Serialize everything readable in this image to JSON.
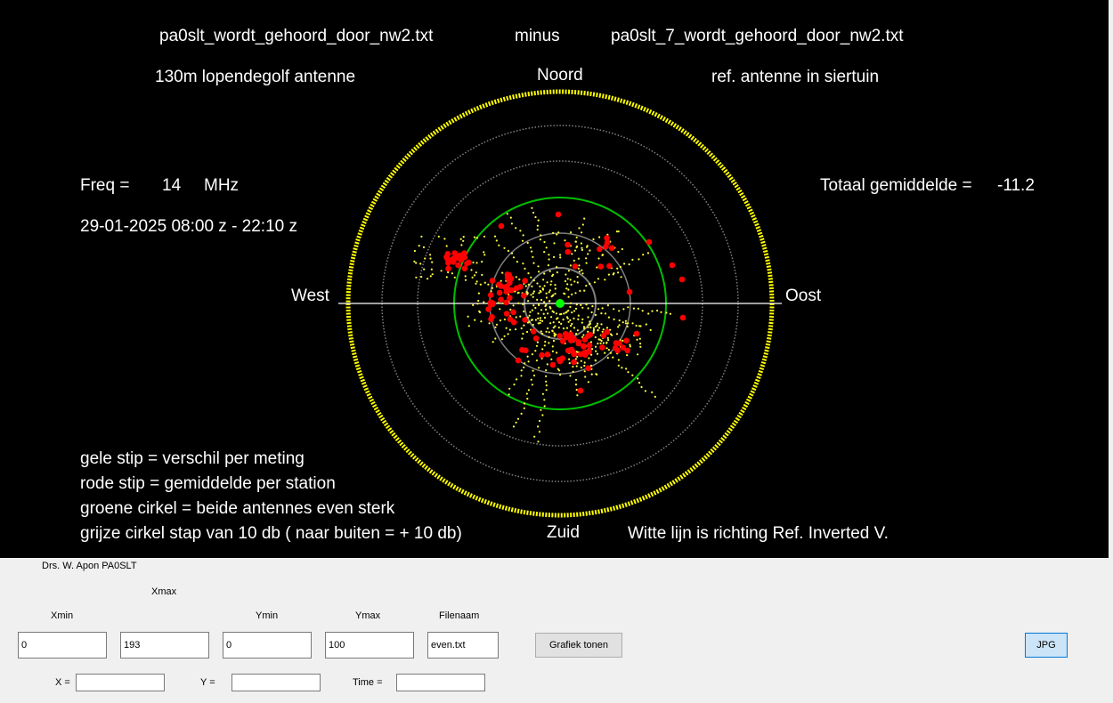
{
  "plot": {
    "header": {
      "file1": "pa0slt_wordt_gehoord_door_nw2.txt",
      "operator": "minus",
      "file2": "pa0slt_7_wordt_gehoord_door_nw2.txt"
    },
    "antenna1": "130m lopendegolf antenne",
    "antenna2": "ref. antenne in siertuin",
    "compass": {
      "north": "Noord",
      "south": "Zuid",
      "west": "West",
      "east": "Oost"
    },
    "freq": {
      "label": "Freq  =",
      "value": "14",
      "unit": "MHz"
    },
    "datetime": "29-01-2025  08:00 z - 22:10  z",
    "total_average": {
      "label": "Totaal gemiddelde =",
      "value": "-11.2"
    },
    "legend": [
      "gele stip =  verschil per meting",
      "rode stip = gemiddelde per station",
      "groene cirkel = beide antennes even sterk",
      "grijze cirkel stap van 10 db ( naar buiten = + 10 db)"
    ],
    "white_line_note": "Witte lijn is richting Ref. Inverted V.",
    "colors": {
      "background": "#000000",
      "outer_circle": "#ffff00",
      "green_circle": "#00c000",
      "grid_circle": "#808080",
      "yellow_dot": "#ffff40",
      "red_dot": "#ff0000",
      "center_dot": "#00ff00",
      "reference_line": "#ffffff"
    }
  },
  "controls": {
    "author": "Drs. W. Apon   PA0SLT",
    "labels": {
      "xmin": "Xmin",
      "xmax": "Xmax",
      "ymin": "Ymin",
      "ymax": "Ymax",
      "filenaam": "Filenaam",
      "x": "X =",
      "y": "Y  =",
      "time": "Time  ="
    },
    "values": {
      "xmin": "0",
      "xmax": "193",
      "ymin": "0",
      "ymax": "100",
      "filenaam": "even.txt",
      "x": "",
      "y": "",
      "time": ""
    },
    "buttons": {
      "grafiek": "Grafiek tonen",
      "jpg": "JPG"
    }
  }
}
